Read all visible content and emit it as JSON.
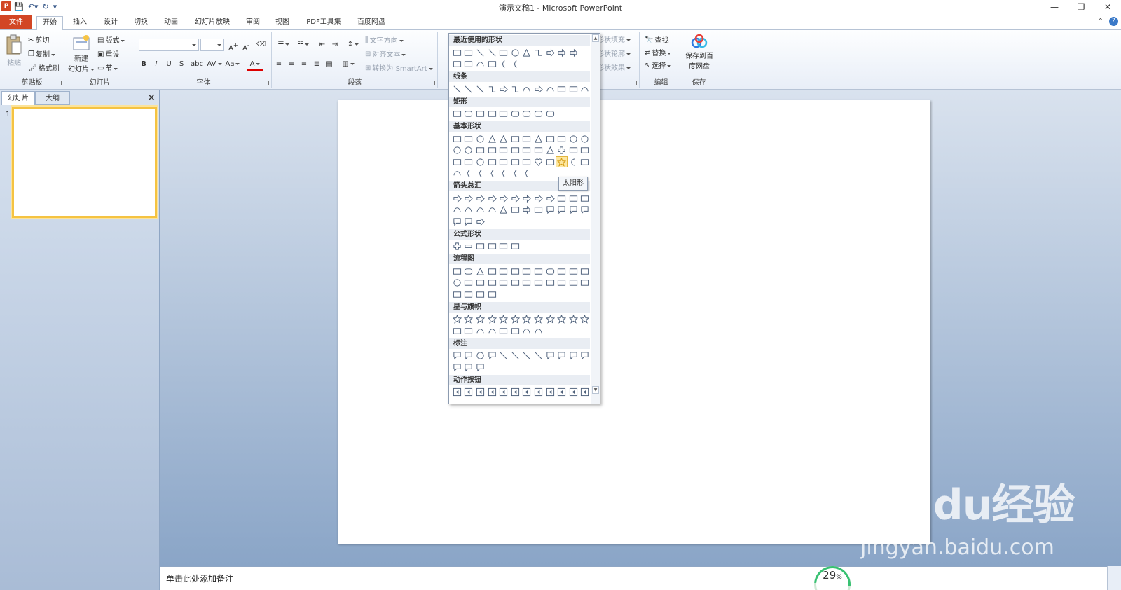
{
  "window": {
    "title": "演示文稿1 - Microsoft PowerPoint",
    "app_badge": "P",
    "controls": [
      "—",
      "❐",
      "✕"
    ]
  },
  "qat": [
    "save-icon",
    "undo-icon",
    "redo-icon",
    "customize-icon"
  ],
  "tabs": {
    "file": "文件",
    "items": [
      "开始",
      "插入",
      "设计",
      "切换",
      "动画",
      "幻灯片放映",
      "审阅",
      "视图",
      "PDF工具集",
      "百度网盘"
    ],
    "active": "开始"
  },
  "ribbon": {
    "clipboard": {
      "label": "剪贴板",
      "paste": "粘贴",
      "cut": "剪切",
      "copy": "复制",
      "format_painter": "格式刷"
    },
    "slides": {
      "label": "幻灯片",
      "new_slide_line1": "新建",
      "new_slide_line2": "幻灯片",
      "layout": "版式",
      "reset": "重设",
      "section": "节"
    },
    "font": {
      "label": "字体",
      "font_name": "",
      "font_size": "",
      "bold": "B",
      "italic": "I",
      "underline": "U",
      "strike": "S",
      "abc": "abc",
      "spacing": "AV",
      "case": "Aa",
      "color": "A"
    },
    "paragraph": {
      "label": "段落",
      "text_direction": "文字方向",
      "align_text": "对齐文本",
      "smartart": "转换为 SmartArt"
    },
    "drawing": {
      "fill": "形状填充",
      "outline": "形状轮廓",
      "effects": "形状效果"
    },
    "editing": {
      "label": "编辑",
      "find": "查找",
      "replace": "替换",
      "select": "选择"
    },
    "save": {
      "label": "保存",
      "button_line1": "保存到百",
      "button_line2": "度网盘"
    }
  },
  "left_pane": {
    "tab_slides": "幻灯片",
    "tab_outline": "大纲",
    "close": "✕",
    "slide_number": "1"
  },
  "shapes_menu": {
    "sections": [
      {
        "title": "最近使用的形状",
        "rows": [
          [
            "textbox",
            "rect-text",
            "line",
            "line-diag",
            "rect",
            "oval",
            "triangle",
            "elbow",
            "elbow-arrow",
            "arrow-right",
            "arrow-down"
          ],
          [
            "pentagon-irregular",
            "freeform",
            "curve-s",
            "angle",
            "brace-left",
            "brace-right"
          ]
        ]
      },
      {
        "title": "线条",
        "rows": [
          [
            "line",
            "arrow-line",
            "double-arrow-line",
            "elbow",
            "elbow-arrow",
            "elbow-double",
            "curve",
            "curve-arrow",
            "curve-double",
            "freeform",
            "freeform-closed",
            "scribble"
          ]
        ]
      },
      {
        "title": "矩形",
        "rows": [
          [
            "rect",
            "round-rect",
            "snip-rect",
            "snip2-rect",
            "snip-diag",
            "snipround",
            "round1",
            "round2",
            "rounddiag"
          ]
        ]
      },
      {
        "title": "基本形状",
        "rows": [
          [
            "textbox",
            "rect-text",
            "oval",
            "triangle",
            "right-tri",
            "parallelogram",
            "trapezoid",
            "diamond",
            "pentagon",
            "hexagon",
            "circle-7",
            "circle-8"
          ],
          [
            "circle-10",
            "circle-12",
            "pie",
            "chord",
            "teardrop",
            "frame",
            "half-frame",
            "l-shape",
            "diag-stripe",
            "plus",
            "octagon",
            "can"
          ],
          [
            "cube",
            "bevel",
            "donut",
            "no-symbol",
            "block-arc",
            "folded",
            "smiley",
            "heart",
            "lightning",
            "sun",
            "moon",
            "cloud"
          ],
          [
            "arc",
            "double-bracket",
            "double-brace",
            "bracket-left",
            "bracket-right",
            "brace-left",
            "brace-right"
          ]
        ]
      },
      {
        "title": "箭头总汇",
        "rows": [
          [
            "arrow-right",
            "arrow-left",
            "arrow-up",
            "arrow-down",
            "arrow-lr",
            "arrow-ud",
            "arrow-quad",
            "arrow-lru",
            "bent-arrow",
            "uturn",
            "left-up",
            "bent-up"
          ],
          [
            "curved-right",
            "curved-left",
            "curved-up",
            "curved-down",
            "striped-right",
            "notched-right",
            "pentagon-arrow",
            "chevron",
            "callout-right",
            "callout-down",
            "callout-left",
            "callout-up"
          ],
          [
            "callout-lr",
            "callout-quad",
            "circular-arrow"
          ]
        ]
      },
      {
        "title": "公式形状",
        "rows": [
          [
            "plus",
            "minus",
            "multiply",
            "divide",
            "equal",
            "not-equal"
          ]
        ]
      },
      {
        "title": "流程图",
        "rows": [
          [
            "process",
            "alt-process",
            "decision",
            "data",
            "predefined",
            "internal-storage",
            "document",
            "multidoc",
            "terminator",
            "preparation",
            "manual-input",
            "manual-op"
          ],
          [
            "connector",
            "offpage",
            "card",
            "punched-tape",
            "summing",
            "or",
            "collate",
            "sort",
            "extract",
            "merge",
            "stored-data",
            "delay"
          ],
          [
            "sequential",
            "magnetic-disk",
            "direct-access",
            "display"
          ]
        ]
      },
      {
        "title": "星与旗帜",
        "rows": [
          [
            "explosion1",
            "explosion2",
            "star4",
            "star5",
            "star6",
            "star7",
            "star8",
            "star10",
            "star12",
            "star16",
            "star24",
            "star32"
          ],
          [
            "ribbon-up",
            "ribbon-down",
            "curved-ribbon-up",
            "curved-ribbon-down",
            "scroll-vertical",
            "scroll-horizontal",
            "wave",
            "double-wave"
          ]
        ]
      },
      {
        "title": "标注",
        "rows": [
          [
            "callout-rect",
            "callout-round",
            "callout-oval",
            "callout-cloud",
            "line-callout1",
            "line-callout2",
            "line-callout3",
            "line-callout4",
            "accent-callout1",
            "accent-callout2",
            "accent-callout3",
            "accent-callout4"
          ],
          [
            "border-callout1",
            "border-callout2",
            "border-callout3"
          ]
        ]
      },
      {
        "title": "动作按钮",
        "rows": [
          [
            "action-back",
            "action-forward",
            "action-begin",
            "action-end",
            "action-home",
            "action-info",
            "action-return",
            "action-movie",
            "action-document",
            "action-sound",
            "action-help",
            "action-blank"
          ]
        ]
      }
    ],
    "hovered_shape": "sun",
    "tooltip": "太阳形"
  },
  "notes": {
    "placeholder": "单击此处添加备注"
  },
  "progress": {
    "value": "29",
    "unit": "%"
  },
  "watermark": {
    "logo": "Baidu经验",
    "url": "jingyan.baidu.com"
  }
}
